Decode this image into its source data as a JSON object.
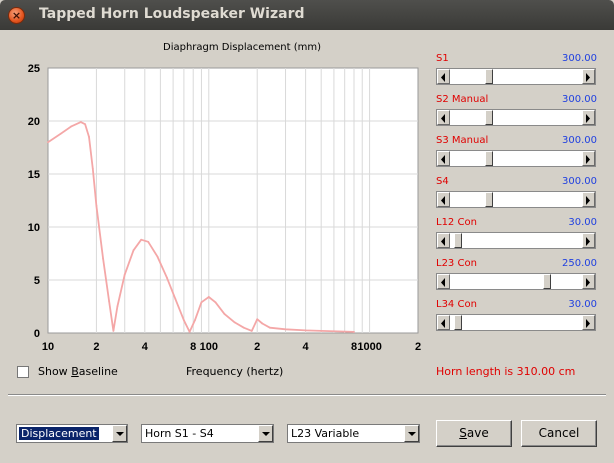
{
  "window": {
    "title": "Tapped Horn Loudspeaker Wizard",
    "close_glyph": "×"
  },
  "chart_data": {
    "type": "line",
    "title": "Diaphragm Displacement (mm)",
    "xlabel": "Frequency (hertz)",
    "ylabel": "",
    "xscale": "log",
    "xlim": [
      10,
      2000
    ],
    "ylim": [
      0,
      25
    ],
    "yticks": [
      "0",
      "5",
      "10",
      "15",
      "20",
      "25"
    ],
    "xticks": [
      {
        "v": 10,
        "label": "10"
      },
      {
        "v": 20,
        "label": "2"
      },
      {
        "v": 40,
        "label": "4"
      },
      {
        "v": 80,
        "label": "8"
      },
      {
        "v": 100,
        "label": "100"
      },
      {
        "v": 200,
        "label": "2"
      },
      {
        "v": 400,
        "label": "4"
      },
      {
        "v": 800,
        "label": "8"
      },
      {
        "v": 1000,
        "label": "1000"
      },
      {
        "v": 2000,
        "label": "2"
      }
    ],
    "grid": true,
    "series": [
      {
        "color": "#f4a7a7",
        "points": [
          [
            10,
            18.0
          ],
          [
            12,
            18.8
          ],
          [
            14,
            19.5
          ],
          [
            16,
            19.9
          ],
          [
            17,
            19.7
          ],
          [
            18,
            18.5
          ],
          [
            19,
            15.5
          ],
          [
            20,
            12.0
          ],
          [
            22,
            7.0
          ],
          [
            24,
            3.0
          ],
          [
            25.5,
            0.2
          ],
          [
            27,
            2.5
          ],
          [
            30,
            5.5
          ],
          [
            34,
            7.8
          ],
          [
            38,
            8.8
          ],
          [
            42,
            8.6
          ],
          [
            48,
            7.2
          ],
          [
            55,
            5.2
          ],
          [
            62,
            3.2
          ],
          [
            70,
            1.2
          ],
          [
            76,
            0.1
          ],
          [
            82,
            1.2
          ],
          [
            90,
            2.9
          ],
          [
            100,
            3.4
          ],
          [
            110,
            2.9
          ],
          [
            125,
            1.8
          ],
          [
            145,
            1.0
          ],
          [
            165,
            0.5
          ],
          [
            185,
            0.2
          ],
          [
            200,
            1.3
          ],
          [
            215,
            0.9
          ],
          [
            240,
            0.5
          ],
          [
            300,
            0.35
          ],
          [
            400,
            0.25
          ],
          [
            500,
            0.2
          ],
          [
            800,
            0.1
          ]
        ]
      }
    ]
  },
  "params": [
    {
      "name": "S1",
      "value": "300.00",
      "level": 0.28
    },
    {
      "name": "S2  Manual",
      "value": "300.00",
      "level": 0.28
    },
    {
      "name": "S3  Manual",
      "value": "300.00",
      "level": 0.28
    },
    {
      "name": "S4",
      "value": "300.00",
      "level": 0.28
    },
    {
      "name": "L12  Con",
      "value": "30.00",
      "level": 0.03
    },
    {
      "name": "L23  Con",
      "value": "250.00",
      "level": 0.75
    },
    {
      "name": "L34  Con",
      "value": "30.00",
      "level": 0.03
    }
  ],
  "show_baseline": {
    "label_pre": "Show ",
    "label_u": "B",
    "label_post": "aseline",
    "checked": false
  },
  "horn_length": "Horn length is 310.00 cm",
  "combos": {
    "mode": "Displacement",
    "horn": "Horn S1 - S4",
    "variable": "L23 Variable"
  },
  "buttons": {
    "save_u": "S",
    "save_rest": "ave",
    "cancel": "Cancel"
  }
}
